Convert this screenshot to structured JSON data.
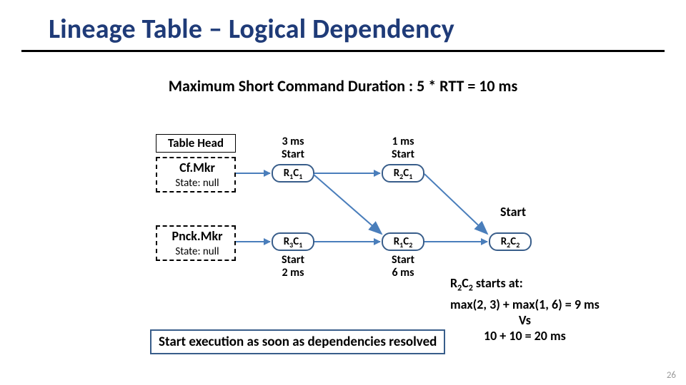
{
  "title": "Lineage Table – Logical Dependency",
  "subtitle": "Maximum Short Command Duration : 5 * RTT = 10 ms",
  "table_head": "Table Head",
  "sources": {
    "cf": {
      "name": "Cf.Mkr",
      "state": "State: null"
    },
    "pn": {
      "name": "Pnck.Mkr",
      "state": "State: null"
    }
  },
  "nodes": {
    "r1c1": {
      "label_html": "R<sub>1</sub>C<sub>1</sub>",
      "top_ann_line1": "3 ms",
      "top_ann_line2": "Start"
    },
    "r2c1": {
      "label_html": "R<sub>2</sub>C<sub>1</sub>",
      "top_ann_line1": "1 ms",
      "top_ann_line2": "Start"
    },
    "r3c1": {
      "label_html": "R<sub>3</sub>C<sub>1</sub>",
      "bot_ann_line1": "Start",
      "bot_ann_line2": "2 ms"
    },
    "r1c2": {
      "label_html": "R<sub>1</sub>C<sub>2</sub>",
      "bot_ann_line1": "Start",
      "bot_ann_line2": "6 ms"
    },
    "r2c2": {
      "label_html": "R<sub>2</sub>C<sub>2</sub>"
    }
  },
  "start_right": "Start",
  "calc": {
    "l1": "R<sub>2</sub>C<sub>2</sub> starts at:",
    "l2": "max(2, 3) + max(1, 6) = 9 ms",
    "l3": "Vs",
    "l4": "10 + 10 = 20 ms"
  },
  "footnote": "Start execution as soon as dependencies resolved",
  "page_num": "26"
}
